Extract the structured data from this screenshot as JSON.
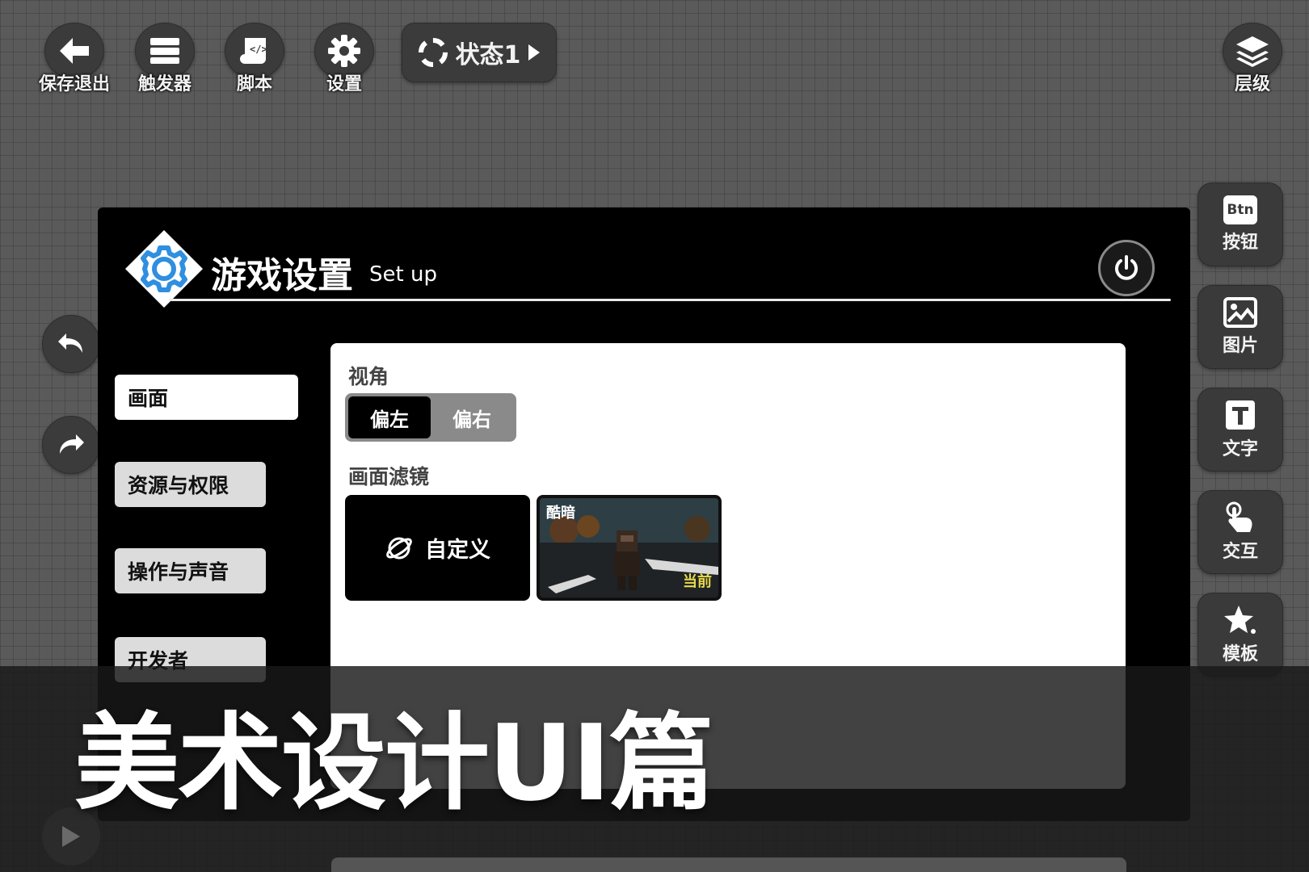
{
  "toolbar": {
    "save_exit": "保存退出",
    "triggers": "触发器",
    "script": "脚本",
    "settings": "设置",
    "state": "状态1",
    "layers": "层级"
  },
  "components": {
    "button": "按钮",
    "button_badge": "Btn",
    "image": "图片",
    "text": "文字",
    "interact": "交互",
    "template": "模板"
  },
  "dialog": {
    "title": "游戏设置",
    "subtitle": "Set up",
    "categories": [
      "画面",
      "资源与权限",
      "操作与声音",
      "开发者"
    ],
    "view_label": "视角",
    "view_options": [
      "偏左",
      "偏右"
    ],
    "filter_label": "画面滤镜",
    "filter_custom": "自定义",
    "filter_dark": "酷暗",
    "filter_current": "当前"
  },
  "caption": "美术设计UI篇",
  "colors": {
    "accent_blue": "#2f8fe0",
    "panel": "#000000",
    "current_tag": "#e6d84a"
  }
}
